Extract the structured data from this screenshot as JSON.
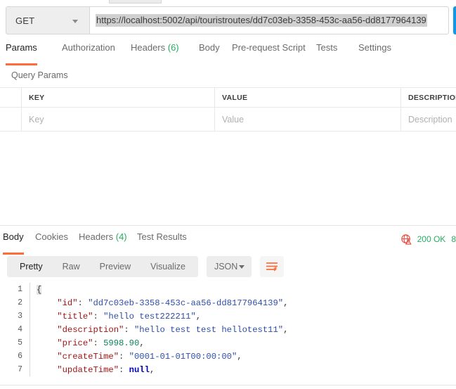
{
  "request": {
    "method": "GET",
    "url": "https://localhost:5002/api/touristroutes/dd7c03eb-3358-453c-aa56-dd8177964139",
    "tabs": [
      {
        "label": "Params",
        "count": "",
        "active": true
      },
      {
        "label": "Authorization",
        "count": "",
        "active": false
      },
      {
        "label": "Headers",
        "count": "(6)",
        "active": false
      },
      {
        "label": "Body",
        "count": "",
        "active": false
      },
      {
        "label": "Pre-request Script",
        "count": "",
        "active": false
      },
      {
        "label": "Tests",
        "count": "",
        "active": false
      },
      {
        "label": "Settings",
        "count": "",
        "active": false
      }
    ],
    "query_params": {
      "section_title": "Query Params",
      "columns": [
        "KEY",
        "VALUE",
        "DESCRIPTION"
      ],
      "rows": [
        {
          "key": "Key",
          "value": "Value",
          "description": "Description"
        }
      ]
    }
  },
  "response": {
    "tabs": [
      {
        "label": "Body",
        "count": "",
        "active": true
      },
      {
        "label": "Cookies",
        "count": "",
        "active": false
      },
      {
        "label": "Headers",
        "count": "(4)",
        "active": false
      },
      {
        "label": "Test Results",
        "count": "",
        "active": false
      }
    ],
    "status": {
      "icon": "globe-warning-icon",
      "code_text": "200 OK",
      "time_text": "8",
      "status_color": "#27ae60"
    },
    "view_modes": [
      {
        "label": "Pretty",
        "active": true
      },
      {
        "label": "Raw",
        "active": false
      },
      {
        "label": "Preview",
        "active": false
      },
      {
        "label": "Visualize",
        "active": false
      }
    ],
    "format": "JSON",
    "wrap_icon": "wrap-lines-icon",
    "body_lines": [
      {
        "no": "1",
        "tokens": [
          {
            "t": "{",
            "c": "tok-brace"
          }
        ]
      },
      {
        "no": "2",
        "tokens": [
          {
            "t": "    ",
            "c": "tok-punc"
          },
          {
            "t": "\"id\"",
            "c": "tok-key"
          },
          {
            "t": ": ",
            "c": "tok-punc"
          },
          {
            "t": "\"dd7c03eb-3358-453c-aa56-dd8177964139\"",
            "c": "tok-str"
          },
          {
            "t": ",",
            "c": "tok-punc"
          }
        ]
      },
      {
        "no": "3",
        "tokens": [
          {
            "t": "    ",
            "c": "tok-punc"
          },
          {
            "t": "\"title\"",
            "c": "tok-key"
          },
          {
            "t": ": ",
            "c": "tok-punc"
          },
          {
            "t": "\"hello test222211\"",
            "c": "tok-str"
          },
          {
            "t": ",",
            "c": "tok-punc"
          }
        ]
      },
      {
        "no": "4",
        "tokens": [
          {
            "t": "    ",
            "c": "tok-punc"
          },
          {
            "t": "\"description\"",
            "c": "tok-key"
          },
          {
            "t": ": ",
            "c": "tok-punc"
          },
          {
            "t": "\"hello test test hellotest11\"",
            "c": "tok-str"
          },
          {
            "t": ",",
            "c": "tok-punc"
          }
        ]
      },
      {
        "no": "5",
        "tokens": [
          {
            "t": "    ",
            "c": "tok-punc"
          },
          {
            "t": "\"price\"",
            "c": "tok-key"
          },
          {
            "t": ": ",
            "c": "tok-punc"
          },
          {
            "t": "5998.90",
            "c": "tok-num"
          },
          {
            "t": ",",
            "c": "tok-punc"
          }
        ]
      },
      {
        "no": "6",
        "tokens": [
          {
            "t": "    ",
            "c": "tok-punc"
          },
          {
            "t": "\"createTime\"",
            "c": "tok-key"
          },
          {
            "t": ": ",
            "c": "tok-punc"
          },
          {
            "t": "\"0001-01-01T00:00:00\"",
            "c": "tok-str"
          },
          {
            "t": ",",
            "c": "tok-punc"
          }
        ]
      },
      {
        "no": "7",
        "tokens": [
          {
            "t": "    ",
            "c": "tok-punc"
          },
          {
            "t": "\"updateTime\"",
            "c": "tok-key"
          },
          {
            "t": ": ",
            "c": "tok-punc"
          },
          {
            "t": "null",
            "c": "tok-null"
          },
          {
            "t": ",",
            "c": "tok-punc"
          }
        ]
      }
    ]
  },
  "colors": {
    "accent": "#ff6c37",
    "success": "#27ae60",
    "send": "#0d99e8"
  }
}
